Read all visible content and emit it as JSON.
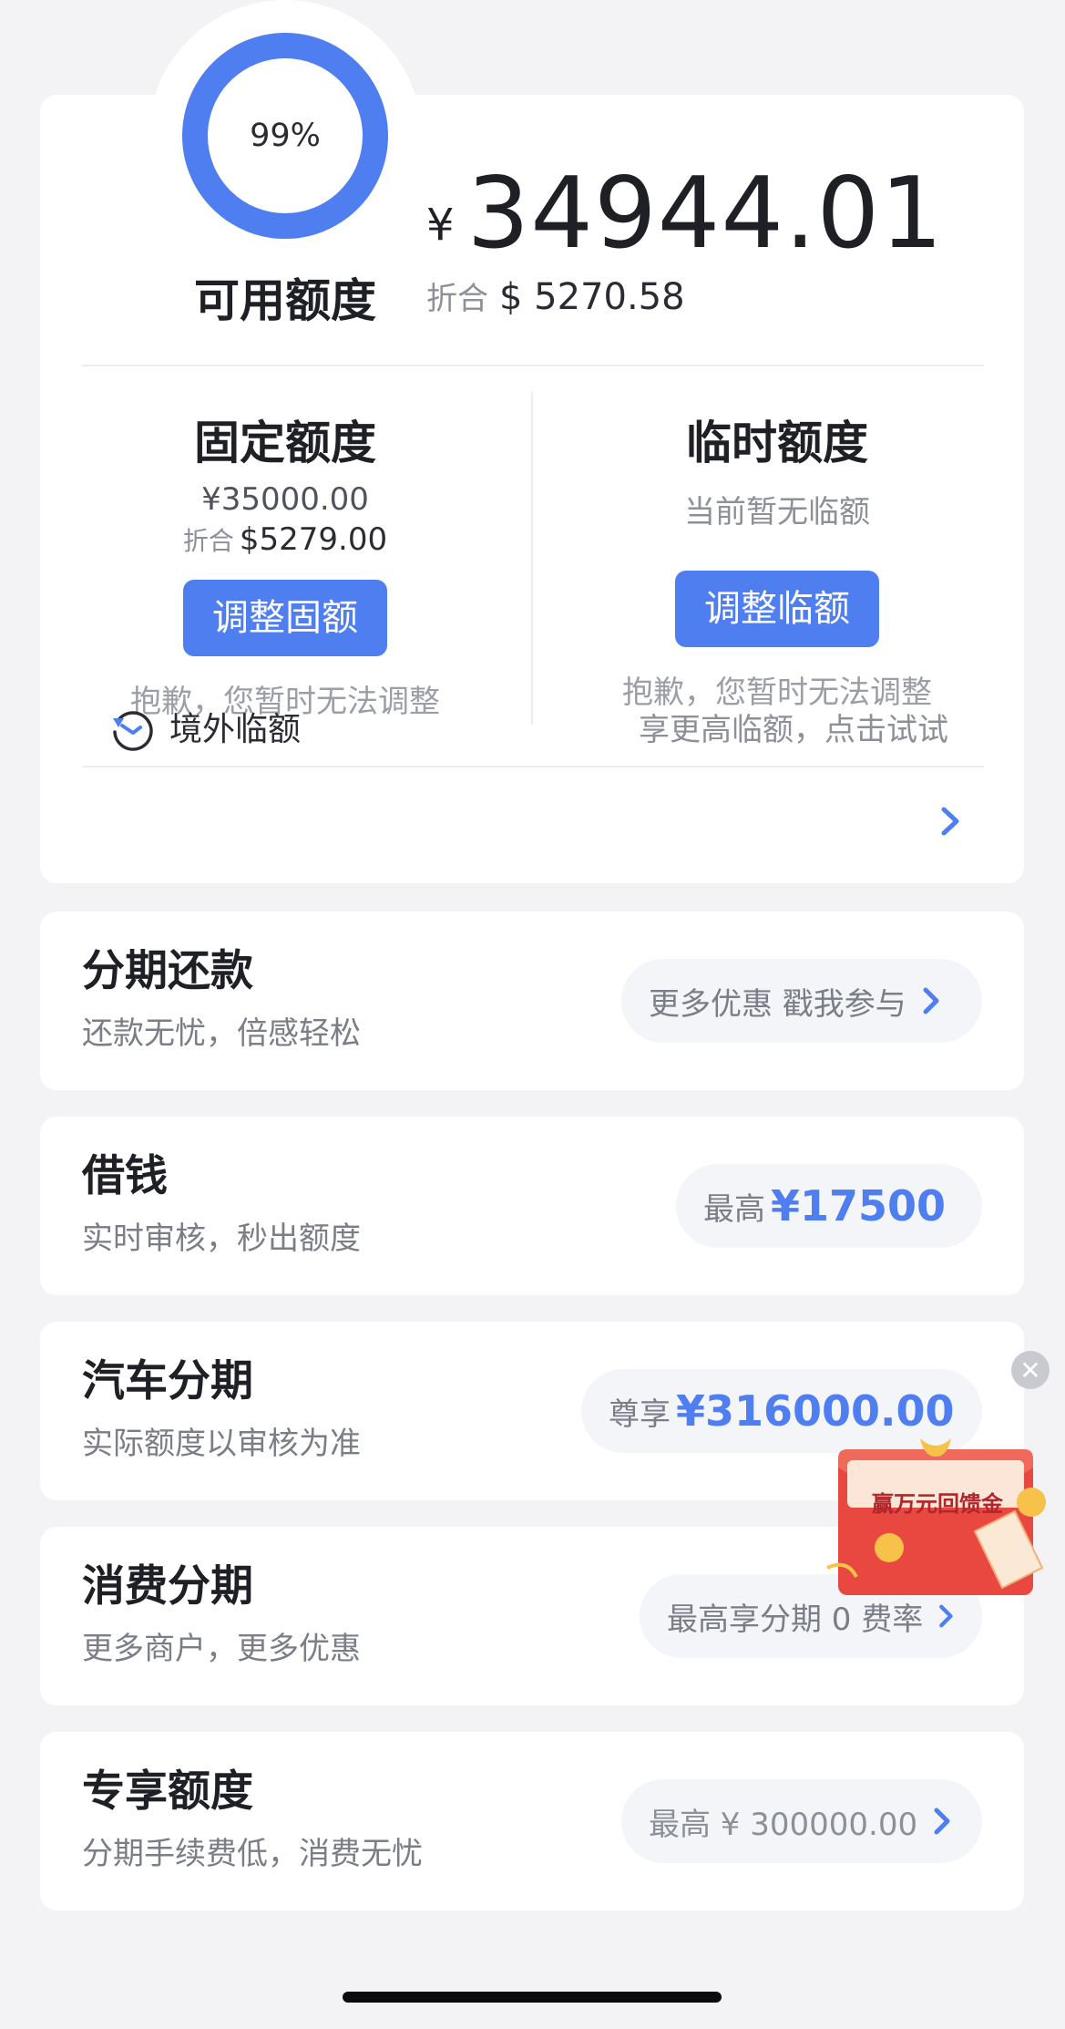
{
  "credit": {
    "usage_percent_label": "99%",
    "usage_fraction": 0.99,
    "available_label": "可用额度",
    "currency_sign": "¥",
    "available_amount": "34944.01",
    "approx_prefix": "折合",
    "approx_value": "$ 5270.58"
  },
  "fixed": {
    "title": "固定额度",
    "amount": "¥35000.00",
    "approx_prefix": "折合",
    "approx_value": "$5279.00",
    "button": "调整固额",
    "note": "抱歉，您暂时无法调整"
  },
  "temporary": {
    "title": "临时额度",
    "status": "当前暂无临额",
    "button": "调整临额",
    "note": "抱歉，您暂时无法调整"
  },
  "overseas": {
    "label": "境外临额",
    "hint": "享更高临额，点击试试"
  },
  "services": [
    {
      "title": "分期还款",
      "subtitle": "还款无忧，倍感轻松",
      "pill_prefix": "更多优惠 戳我参与",
      "pill_value": ""
    },
    {
      "title": "借钱",
      "subtitle": "实时审核，秒出额度",
      "pill_prefix": "最高",
      "pill_value": "¥17500"
    },
    {
      "title": "汽车分期",
      "subtitle": "实际额度以审核为准",
      "pill_prefix": "尊享",
      "pill_value": "¥316000.00"
    },
    {
      "title": "消费分期",
      "subtitle": "更多商户，更多优惠",
      "pill_prefix": "最高享分期 0 费率",
      "pill_value": ""
    },
    {
      "title": "专享额度",
      "subtitle": "分期手续费低，消费无忧",
      "pill_prefix": "最高 ¥ 300000.00",
      "pill_value": ""
    }
  ],
  "promo": {
    "text": "赢万元回馈金",
    "close_symbol": "✕"
  },
  "colors": {
    "accent": "#4f7ef0",
    "background": "#f3f3f5",
    "promo_red": "#e8483f"
  }
}
